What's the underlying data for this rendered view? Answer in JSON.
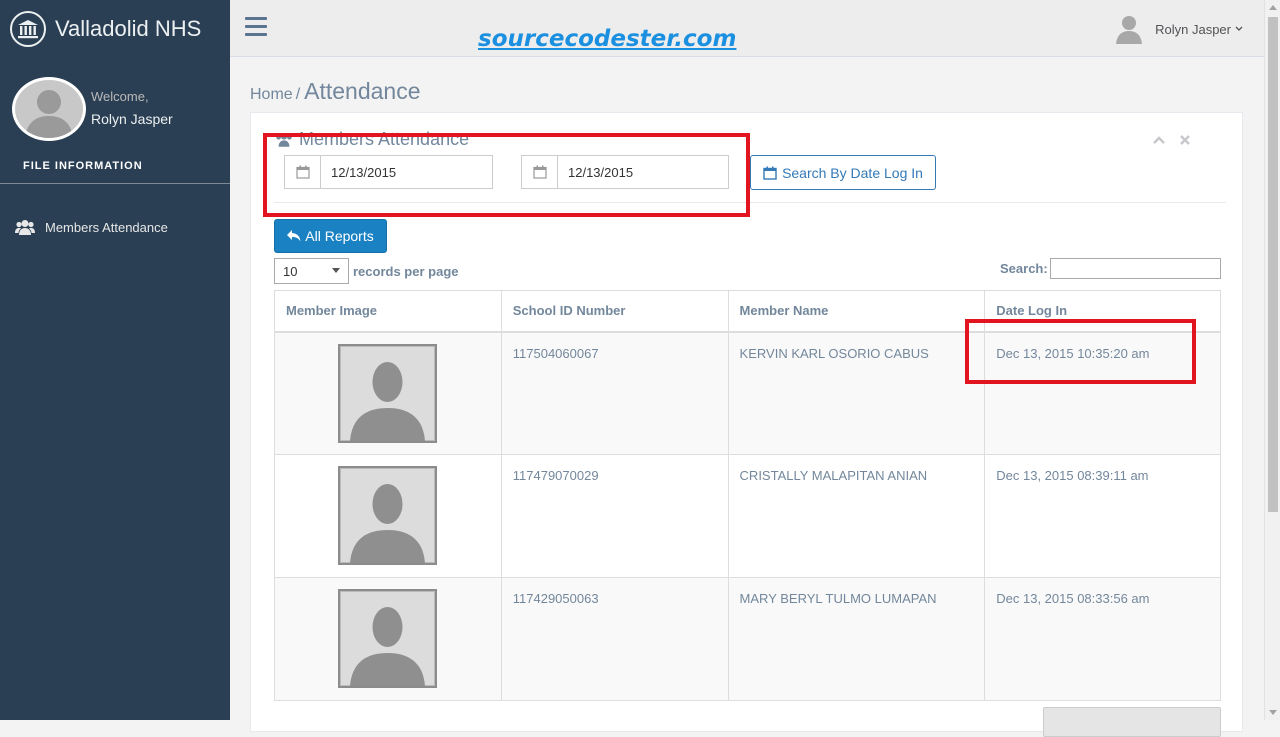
{
  "sidebar": {
    "brand": "Valladolid NHS",
    "welcome": "Welcome,",
    "user_name": "Rolyn Jasper",
    "section_title": "FILE INFORMATION",
    "items": [
      {
        "label": "Members Attendance",
        "icon": "users-icon"
      }
    ]
  },
  "topnav": {
    "watermark": "sourcecodester.com",
    "user_name": "Rolyn Jasper"
  },
  "breadcrumb": {
    "home": "Home",
    "separator": "/",
    "current": "Attendance"
  },
  "panel": {
    "title": "Members Attendance",
    "date_from": "12/13/2015",
    "date_to": "12/13/2015",
    "search_button": "Search By Date Log In",
    "all_reports_button": "All Reports",
    "page_length": "10",
    "records_per_page": "records per page",
    "search_label": "Search:"
  },
  "table": {
    "columns": [
      "Member Image",
      "School ID Number",
      "Member Name",
      "Date Log In"
    ],
    "rows": [
      {
        "id": "117504060067",
        "name": "KERVIN KARL OSORIO CABUS",
        "date": "Dec 13, 2015 10:35:20 am"
      },
      {
        "id": "117479070029",
        "name": "CRISTALLY MALAPITAN ANIAN",
        "date": "Dec 13, 2015 08:39:11 am"
      },
      {
        "id": "117429050063",
        "name": "MARY BERYL TULMO LUMAPAN",
        "date": "Dec 13, 2015 08:33:56 am"
      }
    ]
  },
  "colors": {
    "sidebar_bg": "#2a3f54",
    "primary": "#1a82c3",
    "annotation": "#e2141f"
  }
}
